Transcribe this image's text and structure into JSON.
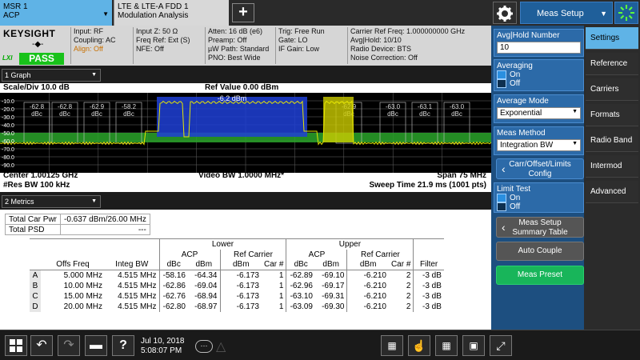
{
  "tabs": [
    {
      "line1": "MSR 1",
      "line2": "ACP"
    },
    {
      "line1": "LTE & LTE-A FDD 1",
      "line2": "Modulation Analysis"
    }
  ],
  "meas_setup_label": "Meas Setup",
  "brand": "KEYSIGHT",
  "status": {
    "pass": "PASS",
    "lxi": "LXI"
  },
  "info": {
    "c1": [
      "Input: RF",
      "Coupling: AC",
      "Align: Off"
    ],
    "c2": [
      "Input Z: 50 Ω",
      "Freq Ref: Ext (S)",
      "NFE: Off"
    ],
    "c3": [
      "Atten: 16 dB (e6)",
      "Preamp: Off",
      "µW Path: Standard",
      "PNO: Best Wide"
    ],
    "c4": [
      "Trig: Free Run",
      "Gate: LO",
      "IF Gain: Low"
    ],
    "c5": [
      "Carrier Ref Freq: 1.000000000 GHz",
      "Avg|Hold: 10/10",
      "Radio Device: BTS",
      "Noise Correction: Off"
    ]
  },
  "graph": {
    "dropdown": "1 Graph",
    "scale": "Scale/Div 10.0 dB",
    "ref": "Ref Value 0.00 dBm",
    "carrier_label": "-6.2 dBm",
    "center": "Center 1.00125 GHz",
    "vbw": "Video BW 1.0000 MHz*",
    "span": "Span 75 MHz",
    "rbw": "#Res BW 100 kHz",
    "sweep": "Sweep Time 21.9 ms (1001 pts)",
    "y_ticks": [
      "-10.0",
      "-20.0",
      "-30.0",
      "-40.0",
      "-50.0",
      "-60.0",
      "-70.0",
      "-80.0",
      "-90.0"
    ],
    "offset_values": [
      "-62.8",
      "-62.8",
      "-62.9",
      "-58.2",
      "-62.9",
      "-63.0",
      "-63.1",
      "-63.0"
    ],
    "offset_unit": "dBc",
    "colors": {
      "carrier": "#1f3fd6",
      "upper_block": "#cccc00",
      "limit": "#2aa52a",
      "trace": "#e6e600"
    }
  },
  "chart_data": {
    "type": "line",
    "title": "",
    "xlabel": "",
    "ylabel": "",
    "x_center_ghz": 1.00125,
    "x_span_mhz": 75,
    "ylim": [
      -100,
      0
    ],
    "y_ticks": [
      -10,
      -20,
      -30,
      -40,
      -50,
      -60,
      -70,
      -80,
      -90
    ],
    "carrier_level_dbm": -6.2,
    "offset_dbc": [
      -62.8,
      -62.8,
      -62.9,
      -58.2,
      -62.9,
      -63.0,
      -63.1,
      -63.0
    ]
  },
  "metrics": {
    "dropdown": "2 Metrics",
    "total_car_pwr_label": "Total Car Pwr",
    "total_car_pwr_value": "-0.637 dBm/26.00 MHz",
    "total_psd_label": "Total PSD",
    "total_psd_value": "---",
    "headers": {
      "lower": "Lower",
      "upper": "Upper",
      "acp": "ACP",
      "ref_carrier": "Ref Carrier",
      "offs_freq": "Offs Freq",
      "integ_bw": "Integ BW",
      "dbc": "dBc",
      "dbm": "dBm",
      "car": "Car #",
      "filter": "Filter"
    },
    "rows": [
      {
        "id": "A",
        "offs": "5.000 MHz",
        "bw": "4.515 MHz",
        "l_dbc": "-58.16",
        "l_dbm": "-64.34",
        "l_ref": "-6.173",
        "l_car": "1",
        "u_dbc": "-62.89",
        "u_dbm": "-69.10",
        "u_ref": "-6.210",
        "u_car": "2",
        "filter": "-3 dB"
      },
      {
        "id": "B",
        "offs": "10.00 MHz",
        "bw": "4.515 MHz",
        "l_dbc": "-62.86",
        "l_dbm": "-69.04",
        "l_ref": "-6.173",
        "l_car": "1",
        "u_dbc": "-62.96",
        "u_dbm": "-69.17",
        "u_ref": "-6.210",
        "u_car": "2",
        "filter": "-3 dB"
      },
      {
        "id": "C",
        "offs": "15.00 MHz",
        "bw": "4.515 MHz",
        "l_dbc": "-62.76",
        "l_dbm": "-68.94",
        "l_ref": "-6.173",
        "l_car": "1",
        "u_dbc": "-63.10",
        "u_dbm": "-69.31",
        "u_ref": "-6.210",
        "u_car": "2",
        "filter": "-3 dB"
      },
      {
        "id": "D",
        "offs": "20.00 MHz",
        "bw": "4.515 MHz",
        "l_dbc": "-62.80",
        "l_dbm": "-68.97",
        "l_ref": "-6.173",
        "l_car": "1",
        "u_dbc": "-63.09",
        "u_dbm": "-69.30",
        "u_ref": "-6.210",
        "u_car": "2",
        "filter": "-3 dB"
      }
    ]
  },
  "right_panel": {
    "avg_hold_label": "Avg|Hold Number",
    "avg_hold_value": "10",
    "averaging_label": "Averaging",
    "on": "On",
    "off": "Off",
    "avg_mode_label": "Average Mode",
    "avg_mode_value": "Exponential",
    "meas_method_label": "Meas Method",
    "meas_method_value": "Integration BW",
    "carr_offset_line1": "Carr/Offset/Limits",
    "carr_offset_line2": "Config",
    "limit_test_label": "Limit Test",
    "summary_line1": "Meas Setup",
    "summary_line2": "Summary Table",
    "auto_couple": "Auto Couple",
    "meas_preset": "Meas Preset",
    "tabs": [
      "Settings",
      "Reference",
      "Carriers",
      "Formats",
      "Radio Band",
      "Intermod",
      "Advanced"
    ]
  },
  "taskbar": {
    "date": "Jul 10, 2018",
    "time": "5:08:07 PM"
  }
}
